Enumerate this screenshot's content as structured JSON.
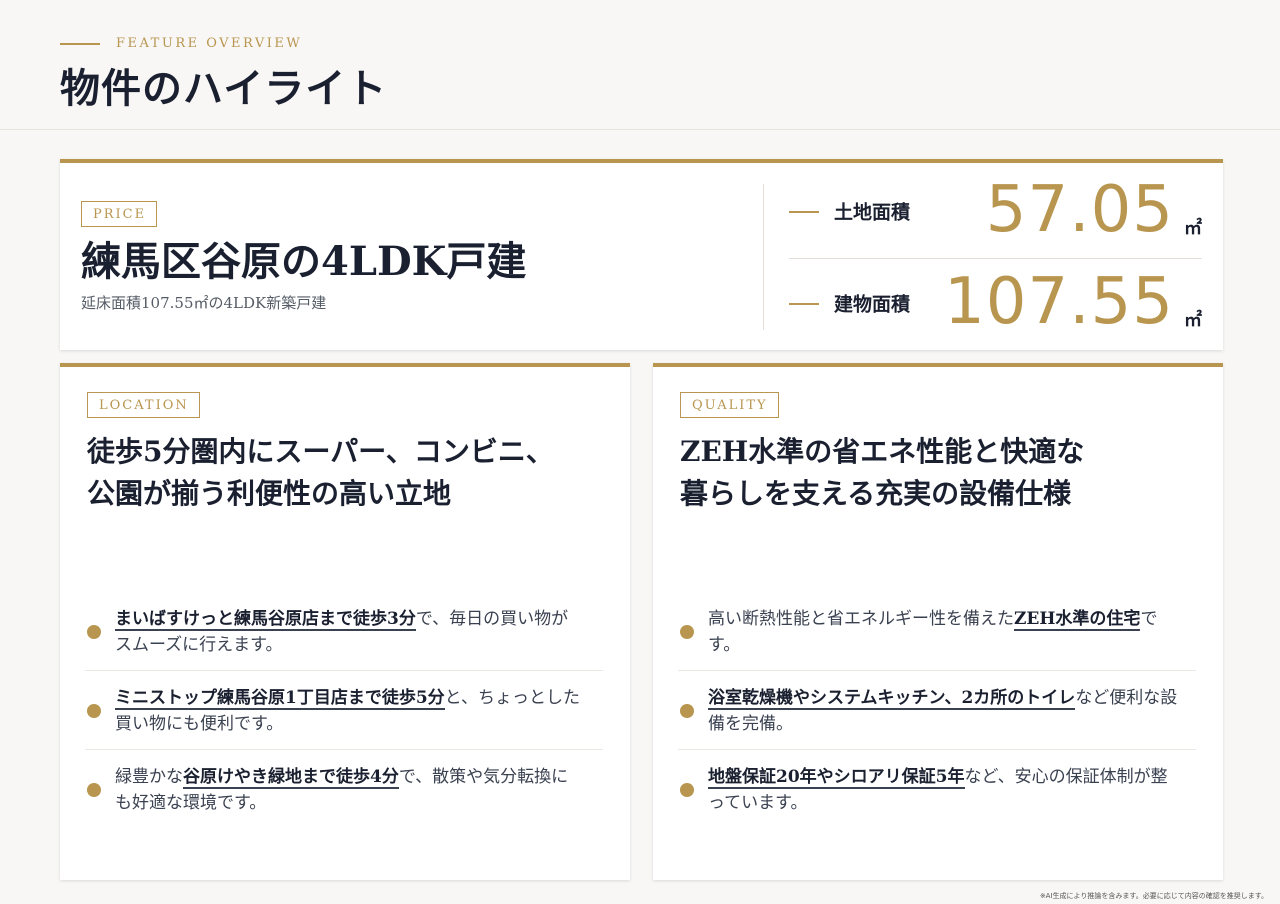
{
  "header": {
    "eyebrow": "FEATURE OVERVIEW",
    "title": "物件のハイライト"
  },
  "price": {
    "tag": "PRICE",
    "title": "練馬区谷原の4LDK戸建",
    "subtitle": "延床面積107.55㎡の4LDK新築戸建",
    "stats": [
      {
        "label": "土地面積",
        "value": "57.05",
        "unit": "㎡"
      },
      {
        "label": "建物面積",
        "value": "107.55",
        "unit": "㎡"
      }
    ]
  },
  "location": {
    "tag": "LOCATION",
    "title_line1": "徒歩5分圏内にスーパー、コンビニ、",
    "title_line2": "公園が揃う利便性の高い立地",
    "bullets": [
      {
        "pre": "",
        "strong": "まいばすけっと練馬谷原店まで徒歩3分",
        "post": "で、毎日の買い物がスムーズに行えます。"
      },
      {
        "pre": "",
        "strong": "ミニストップ練馬谷原1丁目店まで徒歩5分",
        "post": "と、ちょっとした買い物にも便利です。"
      },
      {
        "pre": "緑豊かな",
        "strong": "谷原けやき緑地まで徒歩4分",
        "post": "で、散策や気分転換にも好適な環境です。"
      }
    ]
  },
  "quality": {
    "tag": "QUALITY",
    "title_line1": "ZEH水準の省エネ性能と快適な",
    "title_line2": "暮らしを支える充実の設備仕様",
    "bullets": [
      {
        "pre": "高い断熱性能と省エネルギー性を備えた",
        "strong": "ZEH水準の住宅",
        "post": "です。"
      },
      {
        "pre": "",
        "strong": "浴室乾燥機やシステムキッチン、2カ所のトイレ",
        "post": "など便利な設備を完備。"
      },
      {
        "pre": "",
        "strong": "地盤保証20年やシロアリ保証5年",
        "post": "など、安心の保証体制が整っています。"
      }
    ]
  },
  "footnote": "※AI生成により推論を含みます。必要に応じて内容の確認を推奨します。"
}
